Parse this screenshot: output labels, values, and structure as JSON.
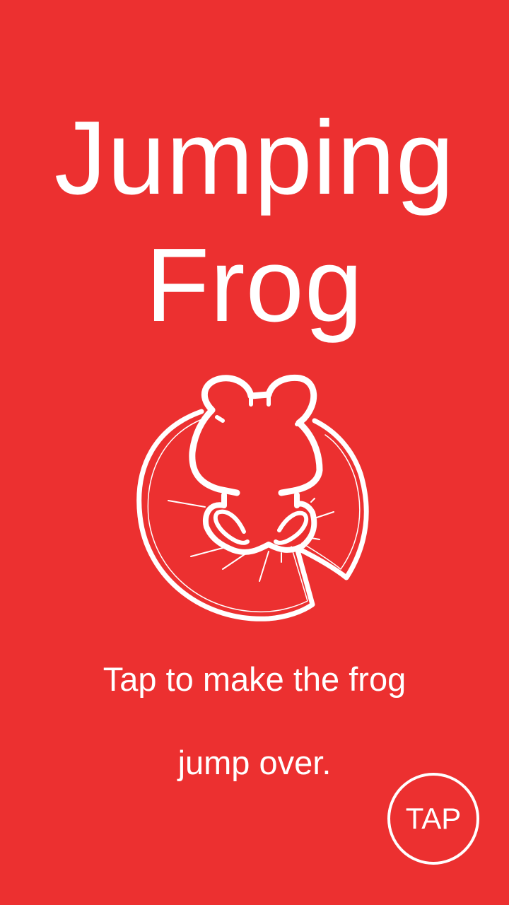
{
  "title": {
    "line1": "Jumping",
    "line2": "Frog"
  },
  "instructions": {
    "line1": "Tap to make the frog",
    "line2": "jump over."
  },
  "tap_button": {
    "label": "TAP"
  },
  "colors": {
    "background": "#ec3030",
    "foreground": "#ffffff"
  },
  "illustration": {
    "icon": "frog-on-lily-pad-icon"
  }
}
